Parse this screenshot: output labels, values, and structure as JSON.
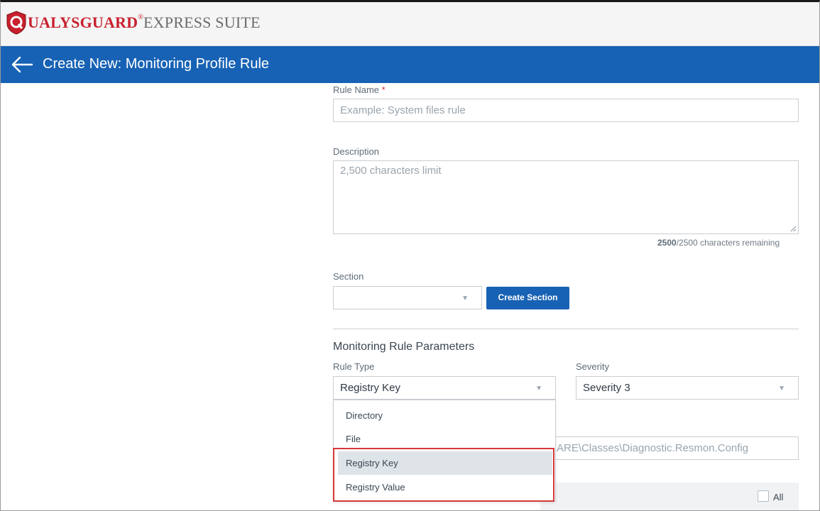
{
  "header": {
    "logo": {
      "q": "Q",
      "ualys": "UALYS",
      "guard": "GUARD",
      "reg": "®",
      "express": "EXPRESS SUITE"
    }
  },
  "titlebar": {
    "back_icon": "arrow-left-icon",
    "title": "Create New: Monitoring Profile Rule"
  },
  "form": {
    "rule_name": {
      "label": "Rule Name",
      "required_mark": "*",
      "placeholder": "Example: System files rule"
    },
    "description": {
      "label": "Description",
      "placeholder": "2,500 characters limit",
      "counter_current": "2500",
      "counter_rest": "/2500 characters remaining"
    },
    "section": {
      "label": "Section",
      "value": "",
      "create_button": "Create Section"
    },
    "parameters": {
      "title": "Monitoring Rule Parameters",
      "rule_type": {
        "label": "Rule Type",
        "value": "Registry Key",
        "options": [
          "Directory",
          "File",
          "Registry Key",
          "Registry Value"
        ],
        "selected_option": "Registry Key"
      },
      "severity": {
        "label": "Severity",
        "value": "Severity 3"
      },
      "path_fragment": "ARE\\Classes\\Diagnostic.Resmon.Config",
      "all_label": "All"
    }
  },
  "colors": {
    "brand_blue": "#1762b4",
    "brand_red": "#c8202d",
    "highlight_red": "#d6383a"
  }
}
